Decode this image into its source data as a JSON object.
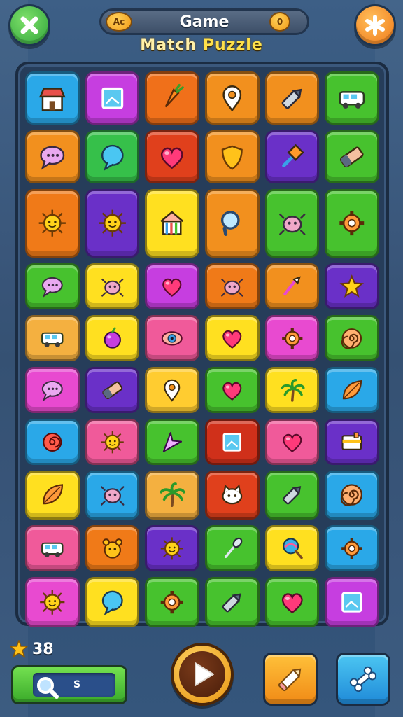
{
  "header": {
    "title": "Game",
    "subtitle_part1": "Match",
    "subtitle_part2": "Puzzle",
    "left_badge": "Ac",
    "right_badge": "0",
    "close_icon": "close-icon",
    "star_icon": "star-burst-icon"
  },
  "board": {
    "rows": [
      [
        {
          "color": "#2aa8e8",
          "icon": "shop"
        },
        {
          "color": "#c63ee0",
          "icon": "frame"
        },
        {
          "color": "#f0701a",
          "icon": "carrot"
        },
        {
          "color": "#f2901e",
          "icon": "pin"
        },
        {
          "color": "#f2901e",
          "icon": "pen"
        },
        {
          "color": "#47c22e",
          "icon": "van"
        }
      ],
      [
        {
          "color": "#f2901e",
          "icon": "chat"
        },
        {
          "color": "#36c04a",
          "icon": "bubble"
        },
        {
          "color": "#e0401c",
          "icon": "heart"
        },
        {
          "color": "#f2901e",
          "icon": "shield"
        },
        {
          "color": "#6a30c8",
          "icon": "pin2"
        },
        {
          "color": "#47c22e",
          "icon": "eraser"
        }
      ],
      [
        {
          "color": "#f07a18",
          "icon": "sun"
        },
        {
          "color": "#6a30c8",
          "icon": "sun"
        },
        {
          "color": "#ffe020",
          "icon": "house"
        },
        {
          "color": "#f2901e",
          "icon": "magnifier"
        },
        {
          "color": "#47c22e",
          "icon": "bug"
        },
        {
          "color": "#47c22e",
          "icon": "gear"
        }
      ],
      [
        {
          "color": "#47c22e",
          "icon": "chat"
        },
        {
          "color": "#ffe020",
          "icon": "bug"
        },
        {
          "color": "#c63ee0",
          "icon": "heart"
        },
        {
          "color": "#f07a18",
          "icon": "bug"
        },
        {
          "color": "#f2901e",
          "icon": "brush"
        },
        {
          "color": "#6a30c8",
          "icon": "star"
        }
      ],
      [
        {
          "color": "#f4b040",
          "icon": "van"
        },
        {
          "color": "#ffe020",
          "icon": "fruit"
        },
        {
          "color": "#f05a9a",
          "icon": "eye"
        },
        {
          "color": "#ffe020",
          "icon": "heart"
        },
        {
          "color": "#e84ad0",
          "icon": "gear"
        },
        {
          "color": "#47c22e",
          "icon": "swirl"
        }
      ],
      [
        {
          "color": "#e84ad0",
          "icon": "chat"
        },
        {
          "color": "#6a30c8",
          "icon": "eraser"
        },
        {
          "color": "#ffcc30",
          "icon": "pin"
        },
        {
          "color": "#47c22e",
          "icon": "heart"
        },
        {
          "color": "#ffe020",
          "icon": "palm"
        },
        {
          "color": "#2aa8e8",
          "icon": "leaf"
        }
      ],
      [
        {
          "color": "#2aa8e8",
          "icon": "flower"
        },
        {
          "color": "#f05a9a",
          "icon": "sun"
        },
        {
          "color": "#47c22e",
          "icon": "arrow"
        },
        {
          "color": "#d0301a",
          "icon": "frame"
        },
        {
          "color": "#f05a9a",
          "icon": "heart"
        },
        {
          "color": "#6a30c8",
          "icon": "card"
        }
      ],
      [
        {
          "color": "#ffe020",
          "icon": "leaf"
        },
        {
          "color": "#2aa8e8",
          "icon": "bug"
        },
        {
          "color": "#f4b040",
          "icon": "palm"
        },
        {
          "color": "#e0401c",
          "icon": "cat"
        },
        {
          "color": "#47c22e",
          "icon": "pen"
        },
        {
          "color": "#2aa8e8",
          "icon": "swirl"
        }
      ],
      [
        {
          "color": "#f05a9a",
          "icon": "van"
        },
        {
          "color": "#f07a18",
          "icon": "bear"
        },
        {
          "color": "#6a30c8",
          "icon": "sun"
        },
        {
          "color": "#47c22e",
          "icon": "spoon"
        },
        {
          "color": "#ffe020",
          "icon": "lolly"
        },
        {
          "color": "#2aa8e8",
          "icon": "gear"
        }
      ],
      [
        {
          "color": "#e84ad0",
          "icon": "sun"
        },
        {
          "color": "#ffe020",
          "icon": "bubble"
        },
        {
          "color": "#47c22e",
          "icon": "gear"
        },
        {
          "color": "#47c22e",
          "icon": "pen"
        },
        {
          "color": "#47c22e",
          "icon": "heart"
        },
        {
          "color": "#c63ee0",
          "icon": "frame"
        }
      ]
    ]
  },
  "footer": {
    "star_count": "38",
    "search_label": "S",
    "play_icon": "play-icon",
    "pencil_icon": "pencil-icon",
    "tool_icon": "bone-wrench-icon"
  }
}
